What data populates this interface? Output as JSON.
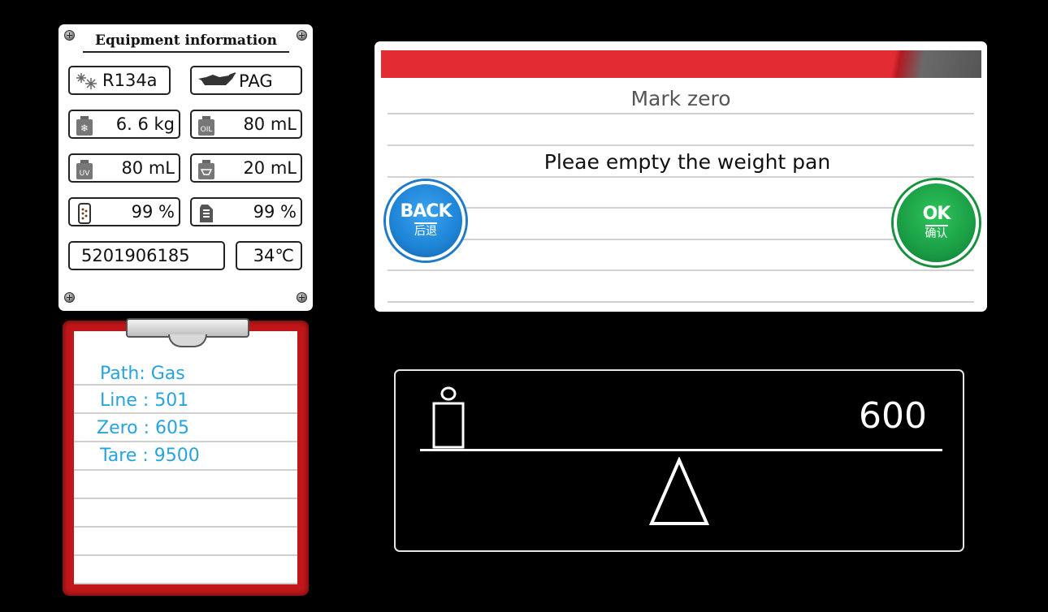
{
  "equipment": {
    "title": "Equipment information",
    "refrigerant": "R134a",
    "oil_type": "PAG",
    "refrigerant_weight": "6. 6 kg",
    "oil_amount": "80 mL",
    "uv_amount": "80 mL",
    "waste_oil_amount": "20 mL",
    "filter_percent": "99 %",
    "tank_percent": "99 %",
    "serial_number": "5201906185",
    "temperature": "34℃"
  },
  "clipboard": {
    "lines": [
      "Path: Gas",
      "Line : 501",
      "Zero : 605",
      "Tare : 9500"
    ]
  },
  "dialog": {
    "title": "Mark zero",
    "message": "Pleae empty the weight pan",
    "back_label": "BACK",
    "back_sub": "后退",
    "ok_label": "OK",
    "ok_sub": "确认"
  },
  "scale": {
    "value": "600"
  },
  "icons": {
    "refrigerant": "snowflake-icon",
    "oil_type": "oil-can-icon",
    "refrigerant_weight": "refrigerant-bottle-icon",
    "oil_amount": "oil-bottle-icon",
    "uv_amount": "uv-bottle-icon",
    "waste_oil_amount": "waste-oil-bottle-icon",
    "filter": "filter-icon",
    "tank": "tank-icon",
    "scale": "weight-icon",
    "pointer": "triangle-pointer-icon"
  },
  "colors": {
    "header_bar": "#e32b34",
    "back_button": "#1e84d6",
    "ok_button": "#1a9e45",
    "clipboard": "#c2171a",
    "clipboard_text": "#27a3dd"
  }
}
